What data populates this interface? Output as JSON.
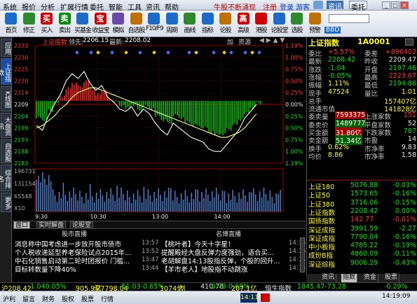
{
  "menu": {
    "items": [
      "系统",
      "报价",
      "分析",
      "扩展行情",
      "委托",
      "智能",
      "工具",
      "资讯",
      "帮助"
    ],
    "promo": "牛股不断涌现",
    "register": "注册",
    "login": "登录",
    "guest": "游客",
    "news_btn": "资讯",
    "entrust_btn": "委托"
  },
  "toolbar": {
    "buttons": [
      {
        "label": "首页",
        "icon": "home-icon",
        "color": "#1c6ac9"
      },
      {
        "label": "修正",
        "icon": "edit-icon",
        "color": "#2c8a2c"
      },
      {
        "label": "买入",
        "icon": "buy-icon",
        "glyph": "买",
        "color": "#d00000"
      },
      {
        "label": "卖出",
        "icon": "sell-icon",
        "glyph": "卖",
        "color": "#0a8a0a"
      },
      {
        "label": "买基金",
        "icon": "buy-fund-icon",
        "color": "#1c6ac9"
      },
      {
        "label": "收益宝",
        "icon": "treasure-icon",
        "glyph": "宝",
        "color": "#d00000"
      },
      {
        "label": "模拟",
        "icon": "simulate-icon",
        "color": "#6a4aa8"
      },
      {
        "label": "自选股",
        "icon": "watchlist-icon",
        "color": "#c07000"
      },
      {
        "label": "F10/F9",
        "icon": "f10-icon",
        "color": "#1c6ac9"
      },
      {
        "label": "周期",
        "icon": "period-icon",
        "color": "#1c6ac9"
      },
      {
        "label": "画线",
        "icon": "draw-icon",
        "color": "#2c8a2c"
      },
      {
        "label": "指标",
        "icon": "indicator-icon",
        "color": "#1c6ac9"
      },
      {
        "label": "论股",
        "icon": "discuss-icon",
        "color": "#c07000"
      },
      {
        "label": "高级",
        "icon": "advanced-icon",
        "glyph": "高",
        "color": "#d00000"
      },
      {
        "label": "港股",
        "icon": "hk-icon",
        "color": "#d00000"
      },
      {
        "label": "论股堂",
        "icon": "forum-icon",
        "color": "#1c6ac9"
      },
      {
        "label": "选股",
        "icon": "pick-icon",
        "color": "#2c8a2c"
      },
      {
        "label": "预警",
        "icon": "alert-icon",
        "color": "#c07000"
      }
    ],
    "bbd": "BBD"
  },
  "sidebar": [
    "应用",
    "上证指数",
    "K线图",
    "大盘资讯",
    "自选股",
    "综合排名",
    "更多"
  ],
  "chart": {
    "title": "上证指数",
    "lead_label": "领先:",
    "lead_value": "2206.15",
    "latest_label": "最新:",
    "latest_value": "2208.02",
    "add_label": "加",
    "resources_label": "资源",
    "left_ticks": [
      "2233",
      "2230",
      "2225",
      "2220",
      "2214",
      "2209",
      "2204",
      "2199",
      "2193",
      "2188",
      "2183"
    ],
    "right_ticks": [
      "1.19%",
      "1.00%",
      "0.75%",
      "0.50%",
      "0.25%",
      "0.00%",
      "0.25%",
      "0.50%",
      "0.75%",
      "1.00%",
      "1.19%"
    ],
    "vol_ticks": [
      "196731",
      "131154",
      "65548"
    ],
    "vol_unit": "X10",
    "time_labels": [
      "9:30",
      "10:30",
      "13:00",
      "14:00"
    ],
    "ref_value": 2209.47
  },
  "chart_data": {
    "type": "line",
    "series": [
      {
        "values": [
          2199,
          2197,
          2203,
          2208,
          2212,
          2218,
          2221,
          2219,
          2222,
          2217,
          2214,
          2216,
          2211,
          2209,
          2206,
          2205,
          2207,
          2203,
          2206,
          2204,
          2200,
          2197,
          2195,
          2200,
          2198,
          2196,
          2194,
          2193,
          2192,
          2189,
          2188,
          2188,
          2191,
          2194,
          2197,
          2202,
          2205,
          2208
        ]
      },
      {
        "values": [
          2198,
          2199,
          2201,
          2203,
          2206,
          2208,
          2211,
          2213,
          2214,
          2215,
          2215,
          2214,
          2213,
          2212,
          2211,
          2210,
          2209,
          2208,
          2207,
          2206,
          2205,
          2204,
          2203,
          2202,
          2201,
          2200,
          2199,
          2198,
          2197,
          2196,
          2195,
          2194,
          2194,
          2195,
          2196,
          2198,
          2201,
          2204
        ]
      }
    ]
  },
  "tabs": [
    "盘口",
    "实时解盘",
    "论股堂"
  ],
  "news": {
    "left_header": "股市直播",
    "right_header": "名博直播",
    "left_items": [
      {
        "text": "消息称中国考虑进一步放开股市债市",
        "time": "13:57"
      },
      {
        "text": "个人税收递延型养老保险试点2015年...",
        "time": "13:52"
      },
      {
        "text": "中石化销售启动第二轮时团报价 门槛...",
        "time": "13:47"
      },
      {
        "text": "目标转数量下降40%",
        "time": "13:44"
      }
    ],
    "right_items": [
      {
        "text": "【桃叶者】今天十字星！",
        "time": "14:15"
      },
      {
        "text": "提醒殿经大盘反弹力度强劲，适合买...",
        "time": "14:15"
      },
      {
        "text": "老胡解盘14:13股指反弹，个股的回升...",
        "time": "14:14"
      },
      {
        "text": "【羊市老人】地股指不动跳涨",
        "time": "14:14"
      }
    ]
  },
  "quote": {
    "name": "上证指数",
    "code": "1A0001",
    "rows": [
      {
        "l1": "委比",
        "v1": "+5.57%",
        "l2": "委差",
        "v2": "+896402",
        "c1": "red",
        "c2": "red"
      },
      {
        "l1": "最新",
        "v1": "2208.42",
        "l2": "昨收",
        "v2": "2209.47",
        "c1": "grn",
        "c2": "wht"
      },
      {
        "l1": "涨跌",
        "v1": "-1.04",
        "l2": "开盘",
        "v2": "2197.46",
        "c1": "grn",
        "c2": "grn"
      },
      {
        "l1": "涨幅",
        "v1": "-0.05%",
        "l2": "最高",
        "v2": "2223.67",
        "c1": "grn",
        "c2": "red"
      },
      {
        "l1": "振幅",
        "v1": "1.11%",
        "l2": "最低",
        "v2": "2194.86",
        "c1": "yel",
        "c2": "grn"
      },
      {
        "l1": "现手",
        "v1": "47524",
        "l2": "量比",
        "v2": "1.01",
        "c1": "yel",
        "c2": "yel"
      },
      {
        "l1": "总手",
        "v1": "",
        "l2": "",
        "v2": "157407亿",
        "c1": "yel",
        "c2": "yel"
      },
      {
        "l1": "流通市值",
        "v1": "",
        "l2": "",
        "v2": "141828亿",
        "c1": "yel",
        "c2": "yel"
      },
      {
        "l1": "委卖量",
        "v1": "7593375",
        "l2": "上涨家数",
        "v2": "151",
        "c1": "box",
        "c2": "red"
      },
      {
        "l1": "委卖价",
        "v1": "1489777",
        "l2": "平盘家数",
        "v2": "52",
        "c1": "boxg",
        "c2": "wht"
      },
      {
        "l1": "买金额",
        "v1": "31.80亿",
        "l2": "下跌家数",
        "v2": "787",
        "c1": "box",
        "c2": "grn"
      },
      {
        "l1": "卖金额",
        "v1": "51.34亿",
        "l2": "市盈",
        "v2": "14",
        "c1": "boxg",
        "c2": "wht"
      },
      {
        "l1": "换手",
        "v1": "0.62%",
        "l2": "市净率",
        "v2": "9.83",
        "c1": "yel",
        "c2": "wht"
      },
      {
        "l1": "均价",
        "v1": "8.86",
        "l2": "市净率",
        "v2": "1.58",
        "c1": "yel",
        "c2": "wht"
      }
    ],
    "indices": [
      {
        "name": "上证180",
        "value": "5076.88",
        "pct": "-0.03%",
        "c": "grn"
      },
      {
        "name": "上证50",
        "value": "1573.65",
        "pct": "-0.16%",
        "c": "grn"
      },
      {
        "name": "上证380",
        "value": "3716.06",
        "pct": "-0.15%",
        "c": "grn"
      },
      {
        "name": "上证指数",
        "value": "2208.42",
        "pct": "0.00%",
        "c": "grn"
      },
      {
        "name": "国债指数",
        "value": "142.77",
        "pct": "-0.01%",
        "c": "red"
      },
      {
        "name": "深证成指",
        "value": "3991.59",
        "pct": "-2.27",
        "c": "grn"
      },
      {
        "name": "深证成指",
        "value": "7790.04",
        "pct": "-0.16%",
        "c": "grn"
      },
      {
        "name": "中小板指",
        "value": "4785.22",
        "pct": "-0.19%",
        "c": "grn"
      },
      {
        "name": "成份B指",
        "value": "4860.09",
        "pct": "-0.11%",
        "c": "grn"
      },
      {
        "name": "深证综指",
        "value": "9006.29",
        "pct": "-0.43%",
        "c": "grn"
      }
    ],
    "tabs": [
      "资讯",
      "指数",
      "资金",
      "股票"
    ]
  },
  "ticker": {
    "items": [
      {
        "t": "沪208.42",
        "c": "yel"
      },
      {
        "t": "-1.040.05%",
        "c": "grn"
      },
      {
        "t": "905.9亿",
        "c": "yel"
      },
      {
        "t": "深7798.04",
        "c": "yel"
      },
      {
        "t": "-51.03-0.65%",
        "c": "grn"
      },
      {
        "t": "1074亿",
        "c": "yel"
      },
      {
        "t": "创",
        "c": "yel"
      },
      {
        "t": "410.76",
        "c": "wht"
      },
      {
        "t": "-9.78-0.69%",
        "c": "grn"
      },
      {
        "t": "207.1亿",
        "c": "yel"
      },
      {
        "t": "恒生指数",
        "c": "wht"
      },
      {
        "t": "1845.47-73.28",
        "c": "grn"
      },
      {
        "t": "-0.29%",
        "c": "grn"
      }
    ]
  },
  "status": {
    "items": [
      "沪利",
      "留言",
      "财务",
      "股权",
      "股票",
      "行情"
    ],
    "clock1": "14:11",
    "clock2": "14:19:09"
  }
}
